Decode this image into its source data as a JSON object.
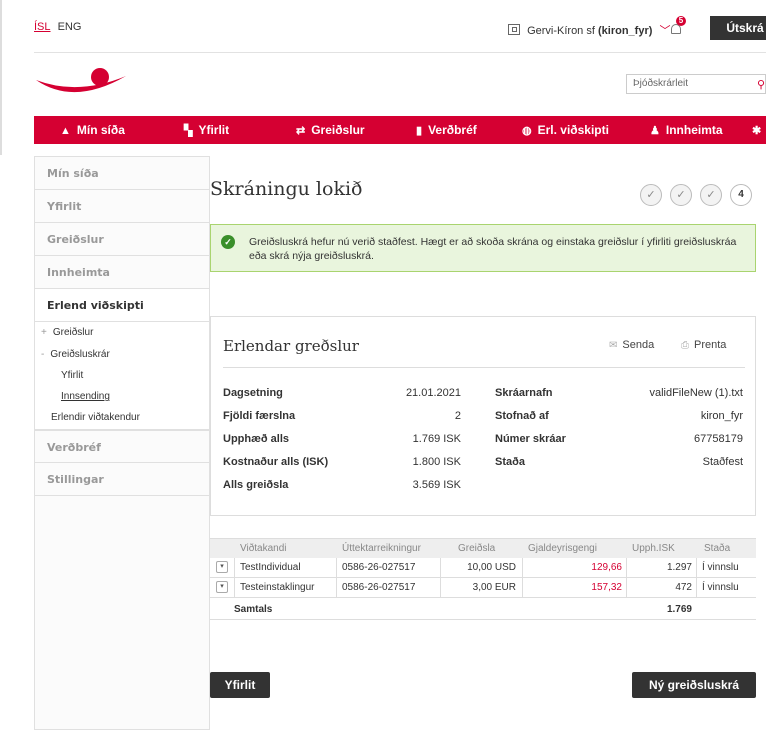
{
  "top": {
    "lang_isl": "ÍSL",
    "lang_eng": "ENG",
    "company": "Gervi-Kíron sf",
    "username": "(kiron_fyr)",
    "notif_count": "5",
    "logout": "Útskrá"
  },
  "search": {
    "placeholder": "Þjóðskrárleit"
  },
  "nav": {
    "items": [
      {
        "label": "Mín síða",
        "icon": "user-icon"
      },
      {
        "label": "Yfirlit",
        "icon": "book-icon"
      },
      {
        "label": "Greiðslur",
        "icon": "transfer-icon"
      },
      {
        "label": "Verðbréf",
        "icon": "bar-chart-icon"
      },
      {
        "label": "Erl. viðskipti",
        "icon": "globe-icon"
      },
      {
        "label": "Innheimta",
        "icon": "person-icon"
      }
    ]
  },
  "sidebar": {
    "items": [
      "Mín síða",
      "Yfirlit",
      "Greiðslur",
      "Innheimta",
      "Erlend viðskipti",
      "Verðbréf",
      "Stillingar"
    ],
    "sub": [
      "Greiðslur",
      "Greiðsluskrár",
      "Yfirlit",
      "Innsending",
      "Erlendir viðtakendur"
    ]
  },
  "page": {
    "title": "Skráningu lokið",
    "steps": [
      "✓",
      "✓",
      "✓",
      "4"
    ]
  },
  "alert": {
    "text": "Greiðsluskrá hefur nú verið staðfest. Hægt er að skoða skrána og einstaka greiðslur í yfirliti greiðsluskráa eða skrá nýja greiðsluskrá."
  },
  "card": {
    "title": "Erlendar greðslur",
    "send": "Senda",
    "print": "Prenta",
    "left": [
      {
        "k": "Dagsetning",
        "v": "21.01.2021"
      },
      {
        "k": "Fjöldi færslna",
        "v": "2"
      },
      {
        "k": "Upphæð alls",
        "v": "1.769 ISK"
      },
      {
        "k": "Kostnaður alls (ISK)",
        "v": "1.800 ISK"
      },
      {
        "k": "Alls greiðsla",
        "v": "3.569 ISK"
      }
    ],
    "right": [
      {
        "k": "Skráarnafn",
        "v": "validFileNew (1).txt"
      },
      {
        "k": "Stofnað af",
        "v": "kiron_fyr"
      },
      {
        "k": "Númer skráar",
        "v": "67758179"
      },
      {
        "k": "Staða",
        "v": "Staðfest"
      }
    ]
  },
  "table": {
    "headers": [
      "Viðtakandi",
      "Úttektarreikningur",
      "Greiðsla",
      "Gjaldeyrisgengi",
      "Upph.ISK",
      "Staða"
    ],
    "rows": [
      [
        "TestIndividual",
        "0586-26-027517",
        "10,00 USD",
        "129,66",
        "1.297",
        "Í vinnslu"
      ],
      [
        "Testeinstaklingur",
        "0586-26-027517",
        "3,00 EUR",
        "157,32",
        "472",
        "Í vinnslu"
      ]
    ],
    "total_label": "Samtals",
    "total_value": "1.769"
  },
  "buttons": {
    "overview": "Yfirlit",
    "new_file": "Ný greiðsluskrá"
  },
  "colors": {
    "brand": "#d50032",
    "success_bg": "#e9f5dd",
    "dark_button": "#333333"
  }
}
